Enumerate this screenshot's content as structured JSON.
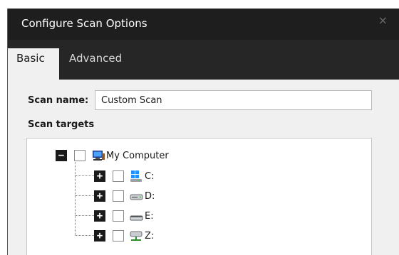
{
  "dialog": {
    "title": "Configure Scan Options",
    "close_glyph": "×",
    "tabs": [
      {
        "label": "Basic",
        "active": true
      },
      {
        "label": "Advanced",
        "active": false
      }
    ]
  },
  "form": {
    "scan_name_label": "Scan name:",
    "scan_name_value": "Custom Scan",
    "scan_targets_label": "Scan targets"
  },
  "tree": {
    "root": {
      "label": "My Computer",
      "expander": "−",
      "icon": "computer-icon",
      "checked": false
    },
    "children": [
      {
        "label": "C:",
        "expander": "+",
        "icon": "windows-drive-icon",
        "checked": false
      },
      {
        "label": "D:",
        "expander": "+",
        "icon": "hard-drive-icon",
        "checked": false
      },
      {
        "label": "E:",
        "expander": "+",
        "icon": "removable-drive-icon",
        "checked": false
      },
      {
        "label": "Z:",
        "expander": "+",
        "icon": "network-drive-icon",
        "checked": false
      }
    ]
  },
  "colors": {
    "titlebar": "#1e1e1e",
    "tabbar": "#262626",
    "panel": "#f0f0f0",
    "tree_background": "#ffffff"
  }
}
